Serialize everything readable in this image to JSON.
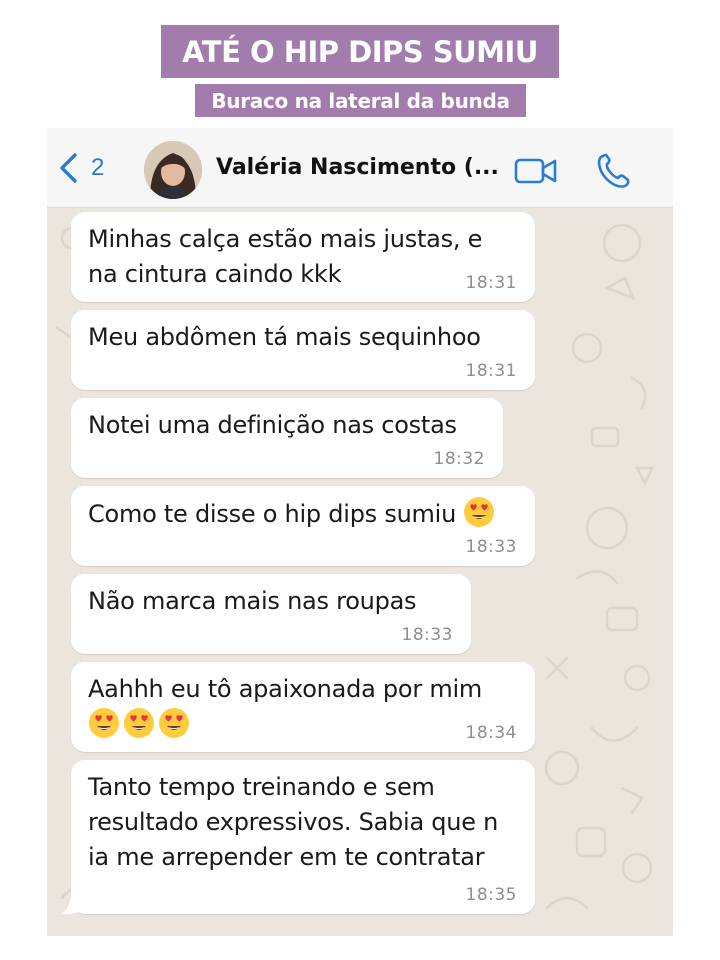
{
  "banner": {
    "title": "ATÉ O HIP DIPS SUMIU",
    "subtitle": "Buraco na lateral da bunda",
    "color": "#a17cac"
  },
  "header": {
    "back_count": "2",
    "contact_name": "Valéria Nascimento (...",
    "icons": [
      "chevron-left-icon",
      "video-camera-icon",
      "phone-icon"
    ],
    "accent_color": "#2a7cd3"
  },
  "messages": [
    {
      "text": "Minhas calça estão mais justas, e\nna cintura caindo kkk",
      "time": "18:31"
    },
    {
      "text": "Meu abdômen tá mais sequinhoo",
      "time": "18:31"
    },
    {
      "text": "Notei uma definição nas costas",
      "time": "18:32"
    },
    {
      "text": "Como te disse o hip dips sumiu",
      "time": "18:33",
      "emoji": "heart-eyes",
      "emoji_count": 1
    },
    {
      "text": "Não marca mais nas roupas",
      "time": "18:33"
    },
    {
      "text": "Aahhh eu tô apaixonada por mim",
      "time": "18:34",
      "emoji": "heart-eyes",
      "emoji_count": 3
    },
    {
      "text": "Tanto tempo treinando e sem\nresultado expressivos. Sabia que n\nia me arrepender em te contratar",
      "time": "18:35"
    }
  ]
}
